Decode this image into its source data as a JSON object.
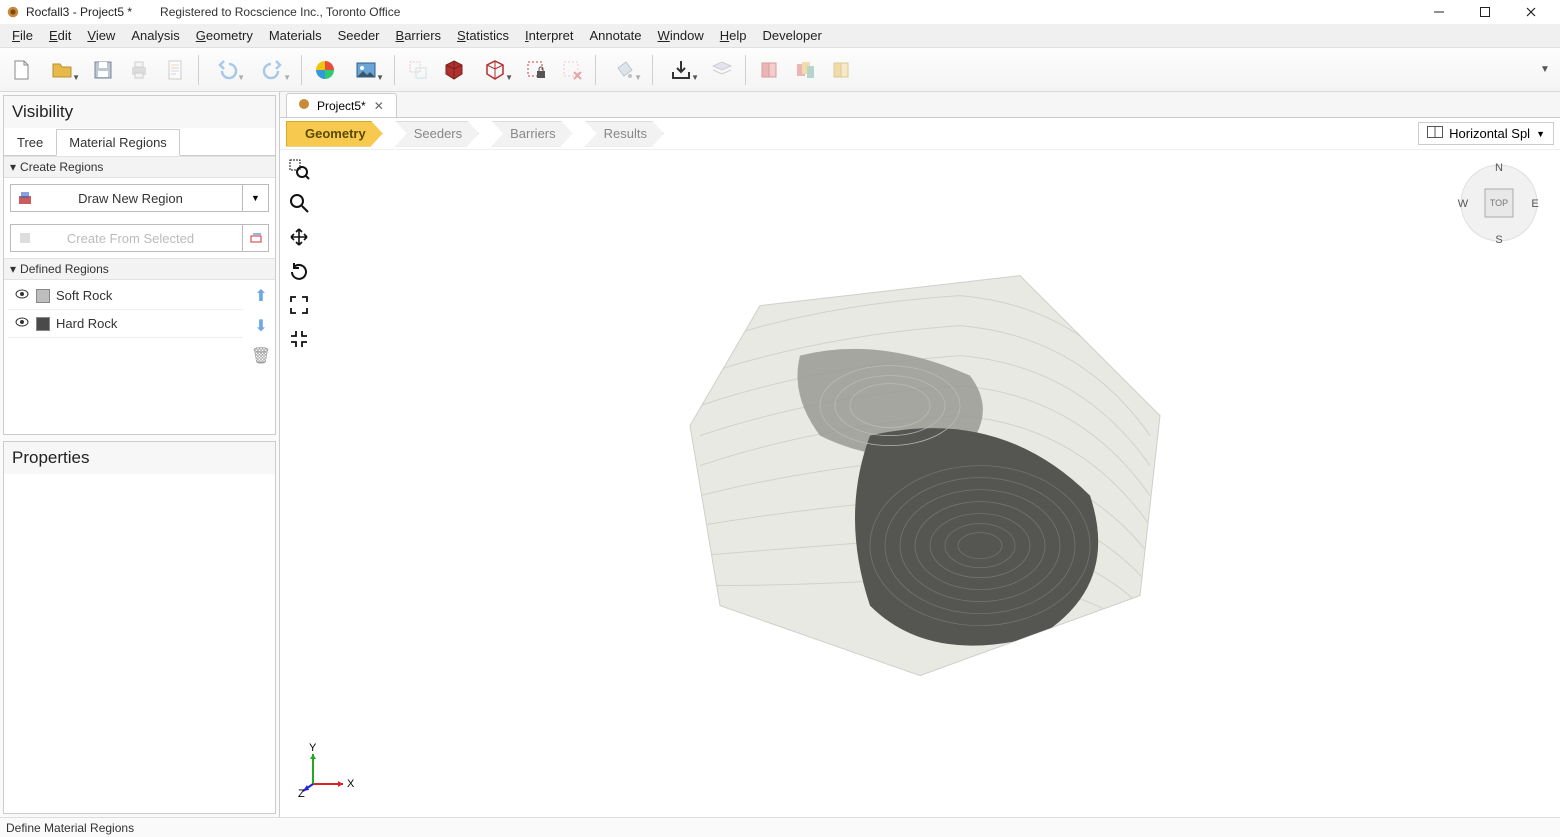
{
  "titlebar": {
    "app_title": "Rocfall3 - Project5 *",
    "registration": "Registered to Rocscience Inc., Toronto Office"
  },
  "menu": {
    "items": [
      "File",
      "Edit",
      "View",
      "Analysis",
      "Geometry",
      "Materials",
      "Seeder",
      "Barriers",
      "Statistics",
      "Interpret",
      "Annotate",
      "Window",
      "Help",
      "Developer"
    ],
    "underline_index": [
      0,
      0,
      0,
      -1,
      0,
      -1,
      -1,
      0,
      0,
      0,
      -1,
      0,
      0,
      -1
    ]
  },
  "toolbar": {
    "buttons": [
      {
        "name": "new-file-icon",
        "dd": false
      },
      {
        "name": "open-folder-icon",
        "dd": true
      },
      {
        "name": "save-icon",
        "dd": false,
        "disabled": false
      },
      {
        "name": "print-icon",
        "dd": false,
        "disabled": true
      },
      {
        "name": "document-icon",
        "dd": false,
        "disabled": true
      },
      {
        "sep": true
      },
      {
        "name": "undo-icon",
        "dd": true,
        "disabled": true
      },
      {
        "name": "redo-icon",
        "dd": true,
        "disabled": true
      },
      {
        "sep": true
      },
      {
        "name": "color-wheel-icon",
        "dd": false
      },
      {
        "name": "image-icon",
        "dd": true
      },
      {
        "sep": true
      },
      {
        "name": "transform-icon",
        "dd": false,
        "disabled": true
      },
      {
        "name": "cube-red-icon",
        "dd": false
      },
      {
        "name": "cube-wire-icon",
        "dd": true
      },
      {
        "name": "selection-lock-icon",
        "dd": false
      },
      {
        "name": "selection-delete-icon",
        "dd": false,
        "disabled": true
      },
      {
        "sep": true
      },
      {
        "name": "bucket-icon",
        "dd": true,
        "disabled": true
      },
      {
        "sep": true
      },
      {
        "name": "import-icon",
        "dd": true
      },
      {
        "name": "layer-icon",
        "dd": false,
        "disabled": true
      },
      {
        "sep": true
      },
      {
        "name": "book-red-icon",
        "dd": false,
        "disabled": true
      },
      {
        "name": "book-stack-icon",
        "dd": false,
        "disabled": true
      },
      {
        "name": "book-gold-icon",
        "dd": false,
        "disabled": true
      }
    ]
  },
  "visibility": {
    "title": "Visibility",
    "tabs": {
      "tree": "Tree",
      "material_regions": "Material Regions",
      "active": "material_regions"
    },
    "create_regions": {
      "header": "Create Regions",
      "draw_new": "Draw New Region",
      "create_from_selected": "Create From Selected"
    },
    "defined_regions": {
      "header": "Defined Regions",
      "items": [
        {
          "label": "Soft Rock",
          "color": "#bdbdbd"
        },
        {
          "label": "Hard Rock",
          "color": "#4a4a4a"
        }
      ]
    }
  },
  "properties": {
    "title": "Properties"
  },
  "document": {
    "tab_label": "Project5*"
  },
  "stages": {
    "items": [
      "Geometry",
      "Seeders",
      "Barriers",
      "Results"
    ],
    "active_index": 0
  },
  "split": {
    "label": "Horizontal Spl"
  },
  "compass": {
    "n": "N",
    "s": "S",
    "e": "E",
    "w": "W",
    "face": "TOP"
  },
  "axis": {
    "x": "X",
    "y": "Y",
    "z": "Z"
  },
  "statusbar": {
    "text": "Define Material Regions"
  }
}
